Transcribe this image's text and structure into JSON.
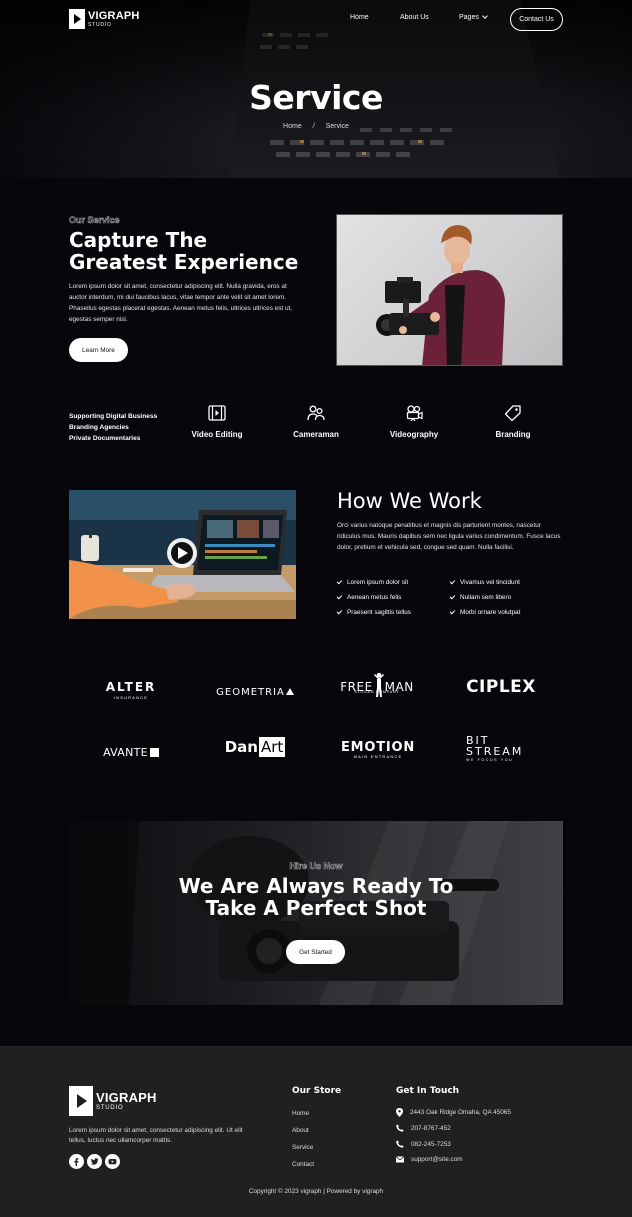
{
  "brand": {
    "name": "VIGRAPH",
    "tagline": "STUDIO"
  },
  "nav": {
    "home": "Home",
    "about": "About Us",
    "pages": "Pages",
    "contact": "Contact Us"
  },
  "hero": {
    "title": "Service",
    "breadcrumb": {
      "home": "Home",
      "separator": "/",
      "current": "Service"
    }
  },
  "about": {
    "eyebrow": "Our Service",
    "title_line1": "Capture The",
    "title_line2": "Greatest Experience",
    "text": "Lorem ipsum dolor sit amet, consectetur adipiscing elit. Nulla gravida, eros at auctor interdum, mi dui faucibus lacus, vitae tempor ante velit sit amet lorem. Phasellus egestas placerat egestas. Aenean metus felis, ultrices ultrices est ut, egestas semper nisl.",
    "button": "Learn More"
  },
  "services": {
    "list": [
      "Supporting Digital Business",
      "Branding Agencies",
      "Private Documentaries"
    ],
    "items": [
      {
        "label": "Video Editing",
        "icon": "film-icon"
      },
      {
        "label": "Cameraman",
        "icon": "people-icon"
      },
      {
        "label": "Videography",
        "icon": "video-camera-icon"
      },
      {
        "label": "Branding",
        "icon": "tag-icon"
      }
    ]
  },
  "work": {
    "title": "How We Work",
    "text": "Orci varius natoque penatibus et magnis dis parturient montes, nascetur ridiculus mus. Mauris dapibus sem nec ligula varius condimentum. Fusce lacus dolor, pretium et vehicula sed, congue sed quam. Nulla facilisi.",
    "checks_left": [
      "Lorem ipsum dolor sit",
      "Aenean metus felis",
      "Praesent sagittis tellus"
    ],
    "checks_right": [
      "Vivamus vel tincidunt",
      "Nullam sem libero",
      "Morbi ornare volutpat"
    ]
  },
  "clients": {
    "alter": {
      "name": "ALTER",
      "sub": "INSURANCE"
    },
    "geometria": {
      "name": "GEOMETRIA"
    },
    "freeman": {
      "name_left": "FREE",
      "name_right": "MAN",
      "sub": "SLOGAN COMPANY"
    },
    "ciplex": {
      "name": "CIPLEX"
    },
    "avante": {
      "name": "AVANTE"
    },
    "danart": {
      "left": "Dan",
      "right": "Art"
    },
    "emotion": {
      "name": "EMOTION",
      "sub": "MAIN ENTRANCE"
    },
    "bitstream": {
      "line1": "BIT",
      "line2": "STREAM",
      "sub": "WE FOCUS YOU"
    }
  },
  "cta": {
    "eyebrow": "Hire Us Now",
    "title_line1": "We Are Always Ready To",
    "title_line2": "Take A Perfect Shot",
    "button": "Get Started"
  },
  "footer": {
    "text": "Lorem ipsum dolor sit amet, consectetur adipiscing elit. Ut elit tellus, luctus nec ullamcorper mattis.",
    "store_heading": "Our Store",
    "store_links": [
      "Home",
      "About",
      "Service",
      "Contact"
    ],
    "contact_heading": "Get In Touch",
    "address": "2443 Oak Ridge Omaha, QA 45065",
    "phone1": "207-8767-452",
    "phone2": "082-245-7253",
    "email": "support@site.com",
    "copyright": "Copyright © 2023 vigraph | Powered by vigraph"
  }
}
